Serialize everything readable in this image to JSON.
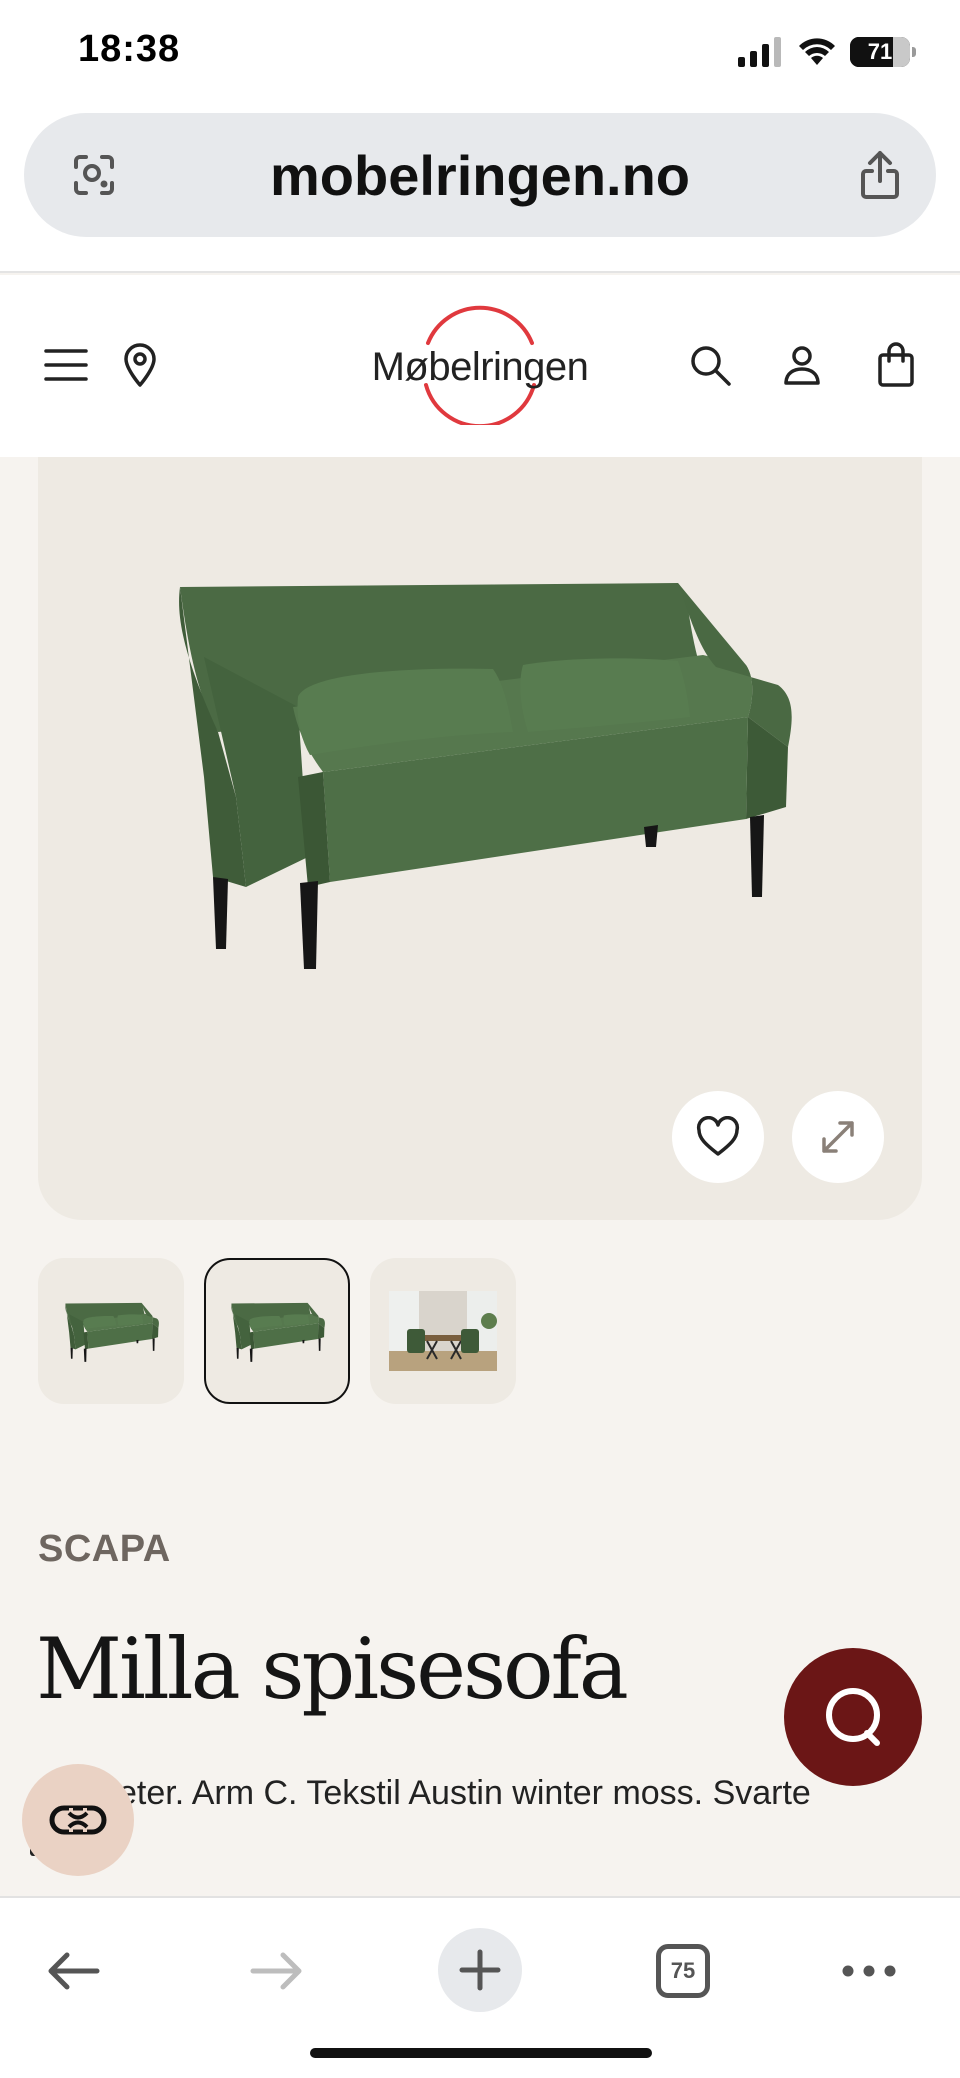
{
  "status_bar": {
    "time": "18:38",
    "battery_percent": "71",
    "battery_level": 0.71,
    "icons": [
      "cellular-signal-icon",
      "wifi-icon",
      "battery-icon"
    ]
  },
  "browser": {
    "url": "mobelringen.no",
    "left_icon": "page-scan-icon",
    "right_icon": "share-icon"
  },
  "site_header": {
    "logo_text": "Møbelringen",
    "brand_color": "#e0393e",
    "icons": [
      "menu-icon",
      "location-pin-icon",
      "search-icon",
      "account-icon",
      "shopping-bag-icon"
    ]
  },
  "product": {
    "brand": "SCAPA",
    "title": "Milla spisesofa",
    "description": "Lengde 185 centimeter. Arm C. Tekstil Austin winter moss. Svarte ben.",
    "description_visible": "eter. Arm C. Tekstil Austin winter moss. Svarte",
    "sofa_color": "#4b6a44",
    "gallery": {
      "thumbnail_count": 3,
      "active_index": 1
    }
  },
  "fabs": {
    "chat_color": "#6b1616",
    "assistant_color": "#ead2c4"
  },
  "toolbar": {
    "tab_count": "75",
    "icons": [
      "back-arrow-icon",
      "forward-arrow-icon",
      "new-tab-plus-icon",
      "tabs-icon",
      "more-dots-icon"
    ]
  }
}
